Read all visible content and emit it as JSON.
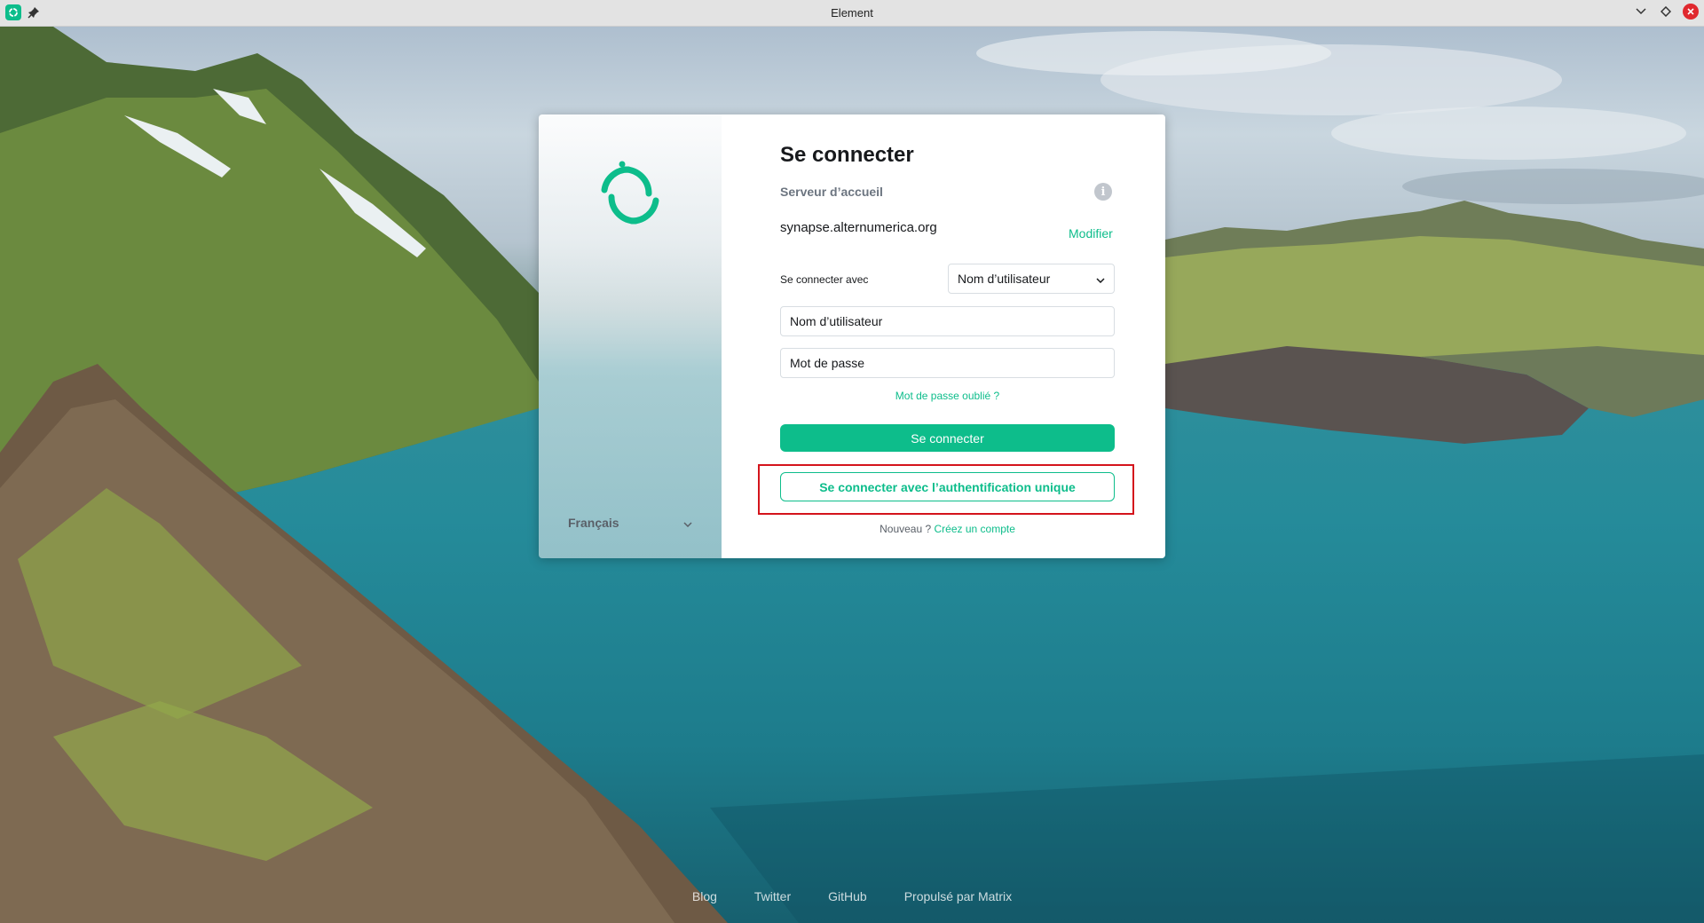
{
  "window": {
    "title": "Element",
    "app_icon": "element-app-icon",
    "controls": [
      "minimize-icon",
      "maximize-icon",
      "close-icon"
    ]
  },
  "login": {
    "title": "Se connecter",
    "homeserver_label": "Serveur d’accueil",
    "homeserver_value": "synapse.alternumerica.org",
    "modify_link": "Modifier",
    "sign_in_with_label": "Se connecter avec",
    "sign_in_with_selected": "Nom d’utilisateur",
    "username_placeholder": "Nom d’utilisateur",
    "password_placeholder": "Mot de passe",
    "forgot_password": "Mot de passe oublié ?",
    "sign_in_button": "Se connecter",
    "sso_button": "Se connecter avec l’authentification unique",
    "new_prefix": "Nouveau ?",
    "create_account": "Créez un compte"
  },
  "language": {
    "selected": "Français"
  },
  "footer": {
    "links": [
      "Blog",
      "Twitter",
      "GitHub",
      "Propulsé par Matrix"
    ]
  },
  "colors": {
    "accent": "#0dbd8b",
    "highlight": "#d4141c"
  }
}
